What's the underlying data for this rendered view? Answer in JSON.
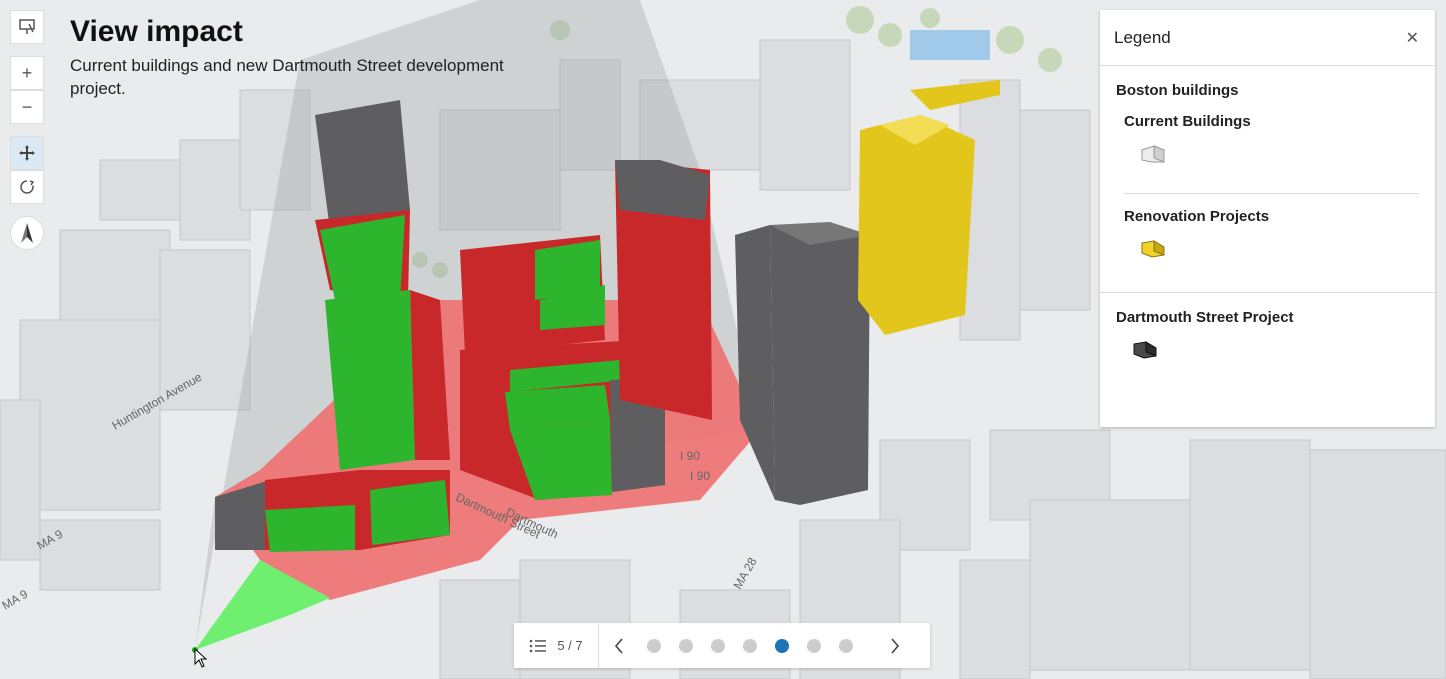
{
  "header": {
    "title": "View impact",
    "subtitle": "Current buildings and new Dartmouth Street development project."
  },
  "map": {
    "street_labels": [
      "Huntington Avenue",
      "MA 9",
      "MA 9",
      "Dartmouth",
      "Dartmouth Street",
      "MA 28",
      "I 90",
      "I 90"
    ],
    "colors": {
      "sunlit": "#2db52d",
      "shadowed": "#c8282a",
      "ground_shadow": "#f07070",
      "viewpoint_area": "#6fef6f",
      "new_project": "#5e5e60",
      "renovation": "#e2c61b",
      "existing": "#d6d7da"
    }
  },
  "toolbar": {
    "icons": [
      "slides-icon",
      "zoom-in-icon",
      "zoom-out-icon",
      "pan-icon",
      "rotate-icon",
      "compass-icon"
    ]
  },
  "legend": {
    "title": "Legend",
    "layers": [
      {
        "title": "Boston buildings",
        "groups": [
          {
            "label": "Current Buildings",
            "color": "#dedede"
          },
          {
            "label": "Renovation Projects",
            "color": "#e0c21a"
          }
        ]
      },
      {
        "title": "Dartmouth Street Project",
        "groups": [
          {
            "label": "",
            "color": "#3b3b3b"
          }
        ]
      }
    ]
  },
  "slides_nav": {
    "counter": "5 / 7",
    "total": 7,
    "current": 5
  }
}
